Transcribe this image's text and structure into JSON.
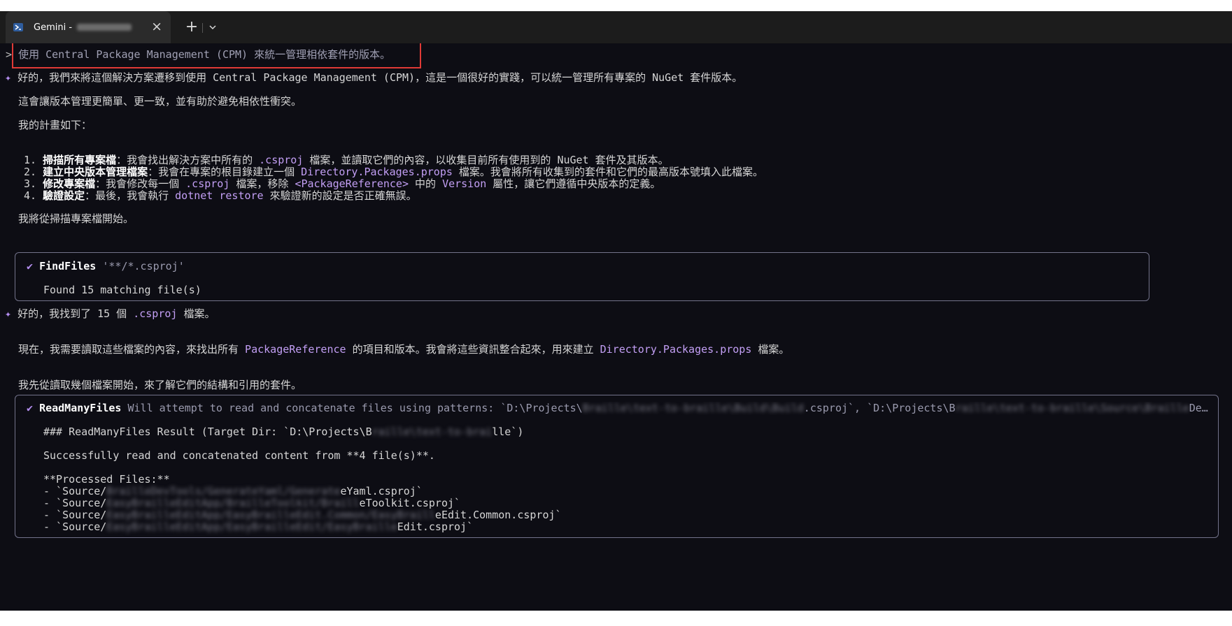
{
  "tab": {
    "title": "Gemini - ",
    "close": "×",
    "new": "+"
  },
  "icons": {
    "tab": "terminal-icon",
    "close": "close-icon",
    "new": "plus-icon",
    "dropdown": "chevron-down-icon",
    "reply": "sparkle-icon",
    "success": "check-icon"
  },
  "colors": {
    "terminal_bg": "#0d0d14",
    "text": "#d6d6d6",
    "keyword": "#c39ff5",
    "highlight_border": "#e03a36",
    "tool_border": "#72728a"
  },
  "prompt": {
    "symbol": ">",
    "text": "使用 Central Package Management (CPM) 來統一管理相依套件的版本。"
  },
  "response1": {
    "intro_pre": "好的，我們來將這個解決方案遷移到使用 Central Package Management (CPM)，這是一個很好的實踐，可以統一管理所有專案的 NuGet 套件版本。",
    "line2": "這會讓版本管理更簡單、更一致，並有助於避免相依性衝突。",
    "plan_heading": "我的計畫如下：",
    "steps": [
      {
        "num": "1.",
        "title": "掃描所有專案檔",
        "pre": "：我會找出解決方案中所有的 ",
        "k1": ".csproj",
        "post": " 檔案，並讀取它們的內容，以收集目前所有使用到的 NuGet 套件及其版本。"
      },
      {
        "num": "2.",
        "title": "建立中央版本管理檔案",
        "pre": "：我會在專案的根目錄建立一個 ",
        "k1": "Directory.Packages.props",
        "post": " 檔案。我會將所有收集到的套件和它們的最高版本號填入此檔案。"
      },
      {
        "num": "3.",
        "title": "修改專案檔",
        "pre": "：我會修改每一個 ",
        "k1": ".csproj",
        "mid1": " 檔案，移除 ",
        "k2": "<PackageReference>",
        "mid2": " 中的 ",
        "k3": "Version",
        "post": " 屬性，讓它們遵循中央版本的定義。"
      },
      {
        "num": "4.",
        "title": "驗證設定",
        "pre": "：最後，我會執行 ",
        "k1": "dotnet restore",
        "post": " 來驗證新的設定是否正確無誤。"
      }
    ],
    "closing": "我將從掃描專案檔開始。"
  },
  "tool1": {
    "name": "FindFiles",
    "args": " '**/*.csproj'",
    "result": "Found 15 matching file(s)"
  },
  "response2": {
    "pre": "好的，我找到了 15 個 ",
    "k": ".csproj",
    "post": " 檔案。",
    "p2_pre": "現在，我需要讀取這些檔案的內容，來找出所有 ",
    "p2_k1": "PackageReference",
    "p2_mid": " 的項目和版本。我會將這些資訊整合起來，用來建立 ",
    "p2_k2": "Directory.Packages.props",
    "p2_post": " 檔案。",
    "p3": "我先從讀取幾個檔案開始，來了解它們的結構和引用的套件。"
  },
  "tool2": {
    "name": "ReadManyFiles",
    "args_a": " Will attempt to read and concatenate files using patterns: `D:\\Projects\\",
    "args_b": "Braille\\text-to-braille\\Build\\Build",
    "args_c": ".csproj`, `D:\\Projects\\B",
    "args_d": "raille\\text-to-braille\\Source\\Braille",
    "args_e": "De…",
    "result_a": "### ReadManyFiles Result (Target Dir: `D:\\Projects\\B",
    "result_b": "raille\\text-to-brai",
    "result_c": "lle`)",
    "success": "Successfully read and concatenated content from **4 file(s)**.",
    "processed_heading": "**Processed Files:**",
    "files": [
      {
        "pre": "- `Source/",
        "blur": "BrailleDevTools/GenerateYaml/Generate",
        "post": "eYaml.csproj`"
      },
      {
        "pre": "- `Source/",
        "blur": "EasyBrailleEditApp/BrailleToolkit/Braill",
        "post": "eToolkit.csproj`"
      },
      {
        "pre": "- `Source/",
        "blur": "EasyBrailleEditApp/EasyBrailleEdit.Common/EasyBraill",
        "post": "eEdit.Common.csproj`"
      },
      {
        "pre": "- `Source/",
        "blur": "EasyBrailleEditApp/EasyBrailleEdit/EasyBraille",
        "post": "Edit.csproj`"
      }
    ]
  }
}
